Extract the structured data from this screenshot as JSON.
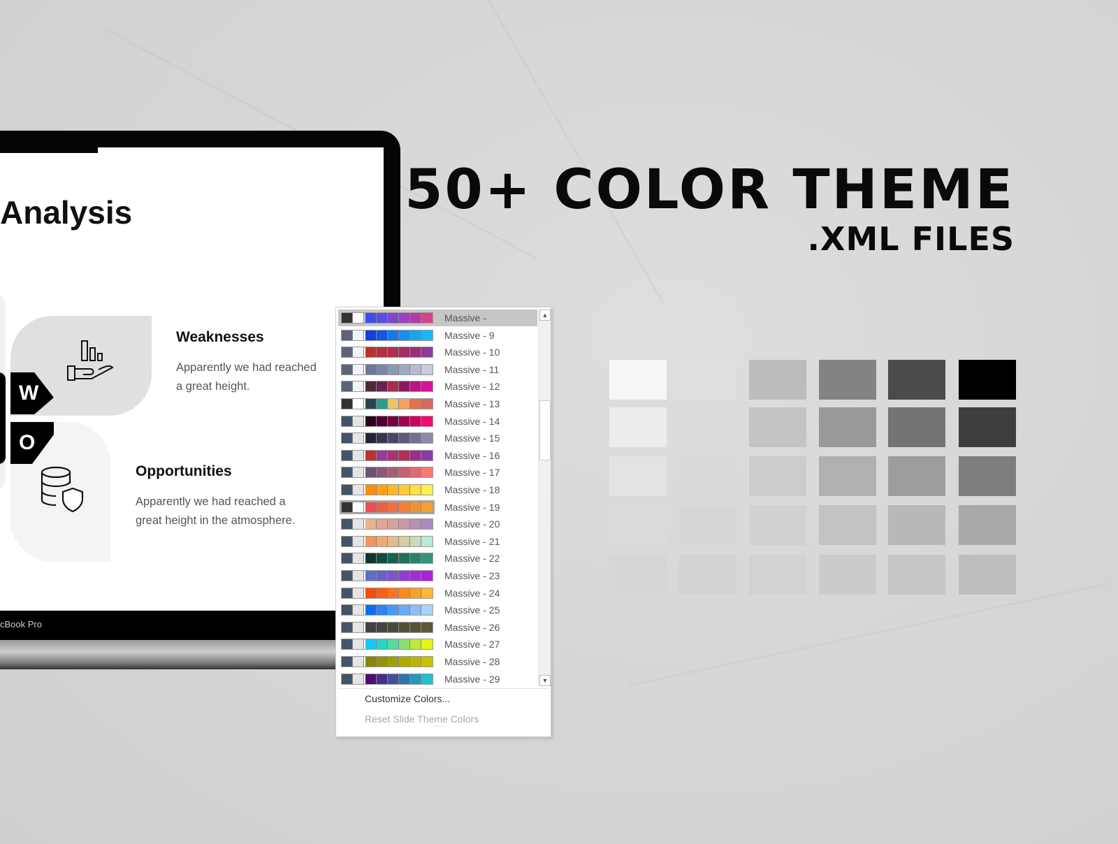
{
  "headline": {
    "line1": "50+ COLOR THEME",
    "line2": ".XML FILES"
  },
  "slide": {
    "title": "Analysis",
    "badges": [
      "W",
      "O"
    ],
    "weaknesses": {
      "heading": "Weaknesses",
      "body1": "Apparently we had reached",
      "body2": "a great height."
    },
    "opportunities": {
      "heading": "Opportunities",
      "body1": "Apparently we had reached a",
      "body2": "great height in the atmosphere."
    },
    "device_label": "cBook Pro",
    "icons": [
      "hand-chart-icon",
      "database-shield-icon"
    ]
  },
  "theme_menu": {
    "items": [
      {
        "label": "Massive -",
        "selected": true,
        "colors": [
          "#333333",
          "#ffffff",
          "#3a4ef0",
          "#5b4be0",
          "#7b46cf",
          "#9a40c0",
          "#b53aa6",
          "#d9428a"
        ]
      },
      {
        "label": "Massive -  9",
        "colors": [
          "#5e6478",
          "#f2f3f8",
          "#0f3fe0",
          "#1158e6",
          "#137aea",
          "#1590ee",
          "#15a6f2",
          "#12bbf7"
        ]
      },
      {
        "label": "Massive - 10",
        "colors": [
          "#5e6478",
          "#f2f3f8",
          "#c0302a",
          "#b92e3e",
          "#ae2e50",
          "#a42e62",
          "#9a2e78",
          "#8e3a98"
        ]
      },
      {
        "label": "Massive - 11",
        "colors": [
          "#5e6478",
          "#f2f3f8",
          "#6d7699",
          "#7b85a6",
          "#8f97b6",
          "#a3a9c4",
          "#b5bad0",
          "#c8ccdc"
        ]
      },
      {
        "label": "Massive - 12",
        "colors": [
          "#5e6478",
          "#f2f3f8",
          "#4c2a3a",
          "#6b2150",
          "#a82c4e",
          "#8a1a5e",
          "#b8167c",
          "#d6139a"
        ]
      },
      {
        "label": "Massive - 13",
        "colors": [
          "#333333",
          "#ffffff",
          "#264653",
          "#2a9d8f",
          "#e9c46a",
          "#f4a261",
          "#e76f51",
          "#d26b60"
        ]
      },
      {
        "label": "Massive - 14",
        "colors": [
          "#44546a",
          "#e5e5e5",
          "#2b0018",
          "#4d0030",
          "#780040",
          "#a3004c",
          "#cc0058",
          "#f50a6e"
        ]
      },
      {
        "label": "Massive - 15",
        "colors": [
          "#44546a",
          "#e5e5e5",
          "#22223b",
          "#363550",
          "#4a4766",
          "#5e5a7a",
          "#73708f",
          "#8d89a6"
        ]
      },
      {
        "label": "Massive - 16",
        "colors": [
          "#44546a",
          "#e5e5e5",
          "#c0302a",
          "#983a98",
          "#a8346e",
          "#b03052",
          "#9a2e88",
          "#8a3aaa"
        ]
      },
      {
        "label": "Massive - 17",
        "colors": [
          "#44546a",
          "#e5e5e5",
          "#6d5275",
          "#8c5875",
          "#a85d75",
          "#c26273",
          "#dd6a70",
          "#fa7a6e"
        ]
      },
      {
        "label": "Massive - 18",
        "colors": [
          "#44546a",
          "#e5e5e5",
          "#ff8c0a",
          "#ffa21a",
          "#ffb828",
          "#ffcc34",
          "#ffe040",
          "#fff050"
        ]
      },
      {
        "label": "Massive - 19",
        "highlighted": true,
        "colors": [
          "#333333",
          "#ffffff",
          "#ea4f55",
          "#ec6048",
          "#ef7040",
          "#f1803a",
          "#f39034",
          "#f5a030"
        ]
      },
      {
        "label": "Massive - 20",
        "colors": [
          "#44546a",
          "#e5e5e5",
          "#eab38e",
          "#e2a894",
          "#d6a0a0",
          "#c89aa8",
          "#b792b2",
          "#a78ac0"
        ]
      },
      {
        "label": "Massive - 21",
        "colors": [
          "#44546a",
          "#e5e5e5",
          "#f6955a",
          "#eeaa72",
          "#e4bc8a",
          "#d8cca0",
          "#c8dcba",
          "#b4ecd8"
        ]
      },
      {
        "label": "Massive - 22",
        "colors": [
          "#44546a",
          "#e5e5e5",
          "#0c3530",
          "#134a40",
          "#1a5e4e",
          "#22705c",
          "#2a826a",
          "#379478"
        ]
      },
      {
        "label": "Massive - 23",
        "colors": [
          "#44546a",
          "#e5e5e5",
          "#5c70c2",
          "#6a62c8",
          "#7c55cc",
          "#903ed2",
          "#a02cd8",
          "#b21ee0"
        ]
      },
      {
        "label": "Massive - 24",
        "colors": [
          "#44546a",
          "#e5e5e5",
          "#fb4a06",
          "#fb5e10",
          "#fb7418",
          "#fb8a20",
          "#fba028",
          "#fbb830"
        ]
      },
      {
        "label": "Massive - 25",
        "colors": [
          "#44546a",
          "#e5e5e5",
          "#0a6ef5",
          "#2a84f5",
          "#4a98f6",
          "#6aabf7",
          "#8abff8",
          "#aad2fa"
        ]
      },
      {
        "label": "Massive - 26",
        "colors": [
          "#44546a",
          "#e5e5e5",
          "#404045",
          "#45453f",
          "#4a4a3a",
          "#505038",
          "#555536",
          "#5a5a34"
        ]
      },
      {
        "label": "Massive - 27",
        "colors": [
          "#44546a",
          "#e5e5e5",
          "#12c8f5",
          "#2ad2c8",
          "#5ad8a0",
          "#8ae070",
          "#baea40",
          "#e8f31a"
        ]
      },
      {
        "label": "Massive - 28",
        "colors": [
          "#44546a",
          "#e5e5e5",
          "#86880a",
          "#949308",
          "#a29e06",
          "#b0aa04",
          "#bcb602",
          "#c8c200"
        ]
      },
      {
        "label": "Massive - 29",
        "colors": [
          "#44546a",
          "#e5e5e5",
          "#4a0e70",
          "#4a2e86",
          "#40509a",
          "#3272ac",
          "#2498bc",
          "#22c0cc"
        ]
      }
    ],
    "customize_label": "Customize Colors...",
    "reset_label": "Reset Slide Theme Colors",
    "grip": "...."
  },
  "gray_grid": [
    [
      "#f6f6f6",
      "#e0e0e0",
      "#bcbcbc",
      "#838383",
      "#4b4b4b",
      "#000000"
    ],
    [
      "#ececec",
      "#dcdcdc",
      "#c4c4c4",
      "#999999",
      "#747474",
      "#3e3e3e"
    ],
    [
      "#e3e3e3",
      "#d9d9d9",
      "#cccccc",
      "#b0b0b0",
      "#9d9d9d",
      "#7e7e7e"
    ],
    [
      "#dbdbdb",
      "#d6d6d6",
      "#d1d1d1",
      "#c3c3c3",
      "#b8b8b8",
      "#a8a8a8"
    ],
    [
      "#d6d6d6",
      "#d3d3d3",
      "#d2d2d2",
      "#cbcbcb",
      "#c6c6c6",
      "#bebebe"
    ]
  ]
}
